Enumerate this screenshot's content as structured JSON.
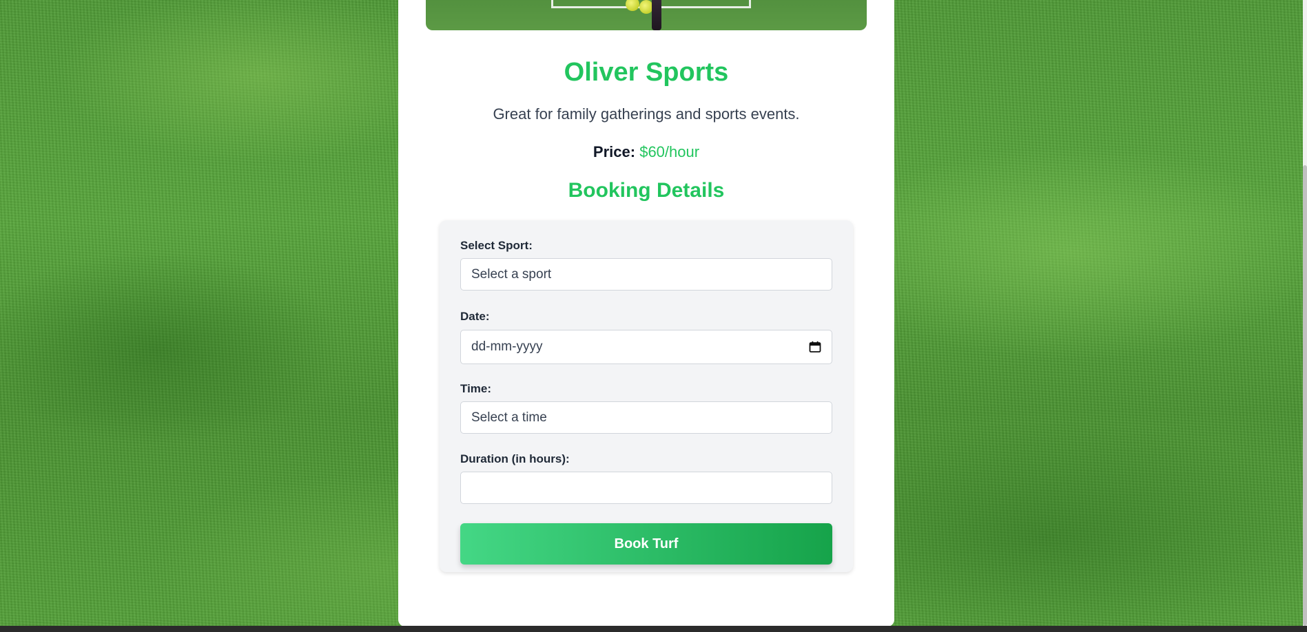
{
  "venue": {
    "name": "Oliver Sports",
    "description": "Great for family gatherings and sports events.",
    "price_label": "Price:",
    "price_value": "$60/hour"
  },
  "booking": {
    "heading": "Booking Details",
    "sport_label": "Select Sport:",
    "sport_value": "Select a sport",
    "date_label": "Date:",
    "date_placeholder": "dd-mm-yyyy",
    "time_label": "Time:",
    "time_value": "Select a time",
    "duration_label": "Duration (in hours):",
    "duration_value": "",
    "submit_label": "Book Turf"
  },
  "icons": {
    "date_field": "calendar-icon"
  },
  "colors": {
    "accent": "#22c55e",
    "button_gradient_start": "#44d785",
    "button_gradient_end": "#16a34a",
    "form_background": "#f3f4f6"
  }
}
